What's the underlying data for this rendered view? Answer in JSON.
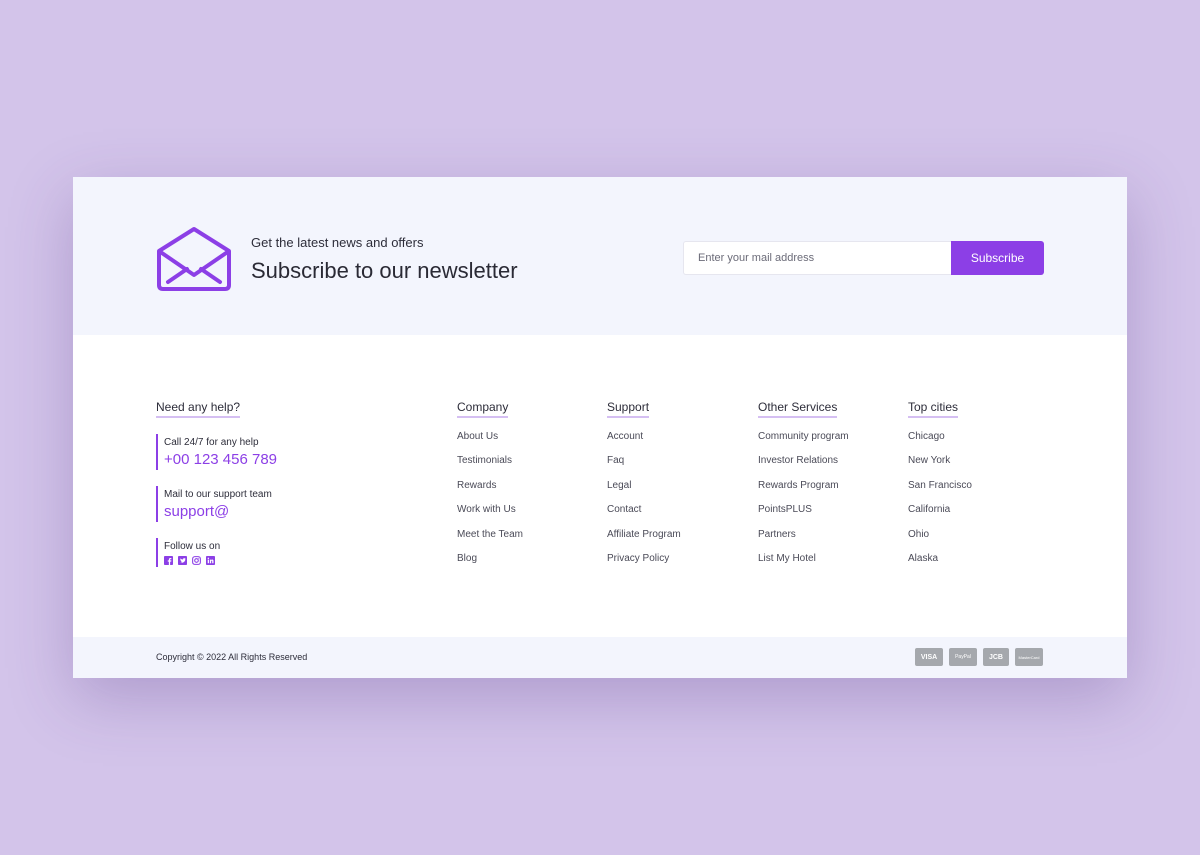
{
  "newsletter": {
    "kicker": "Get the latest news and offers",
    "title": "Subscribe to our newsletter",
    "input_placeholder": "Enter your mail address",
    "button_label": "Subscribe",
    "icon": "envelope-open-icon"
  },
  "help": {
    "heading": "Need any help?",
    "call_label": "Call 24/7 for any help",
    "call_value": "+00 123 456 789",
    "mail_label": "Mail to our support team",
    "mail_value": "support@",
    "follow_label": "Follow us on",
    "socials": [
      "facebook-icon",
      "twitter-icon",
      "instagram-icon",
      "linkedin-icon"
    ]
  },
  "columns": [
    {
      "heading": "Company",
      "links": [
        "About Us",
        "Testimonials",
        "Rewards",
        "Work with Us",
        "Meet the Team",
        "Blog"
      ]
    },
    {
      "heading": "Support",
      "links": [
        "Account",
        "Faq",
        "Legal",
        "Contact",
        "Affiliate Program",
        "Privacy Policy"
      ]
    },
    {
      "heading": "Other Services",
      "links": [
        "Community program",
        "Investor Relations",
        "Rewards Program",
        "PointsPLUS",
        "Partners",
        "List My Hotel"
      ]
    },
    {
      "heading": "Top cities",
      "links": [
        "Chicago",
        "New York",
        "San Francisco",
        "California",
        "Ohio",
        "Alaska"
      ]
    }
  ],
  "bottom": {
    "copyright": "Copyright © 2022 All Rights Reserved",
    "payments": [
      "VISA",
      "PayPal",
      "JCB",
      "MasterCard"
    ]
  },
  "colors": {
    "accent": "#8c3fe6",
    "page_background": "#d3c4ea",
    "band_background": "#f3f5fd"
  }
}
